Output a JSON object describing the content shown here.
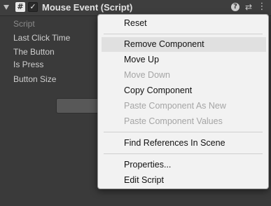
{
  "component": {
    "title": "Mouse Event (Script)",
    "enabled": true,
    "script_icon_glyph": "#",
    "check_glyph": "✓",
    "help_glyph": "?",
    "preset_glyph": "⇄",
    "more_glyph": "⋮"
  },
  "fields": {
    "script": "Script",
    "last_click_time": "Last Click Time",
    "the_button": "The Button",
    "is_press": "Is Press",
    "button_size": "Button Size"
  },
  "context_menu": {
    "hovered_item": "Remove Component",
    "items": [
      {
        "label": "Reset",
        "enabled": true
      },
      {
        "label": "Remove Component",
        "enabled": true
      },
      {
        "label": "Move Up",
        "enabled": true
      },
      {
        "label": "Move Down",
        "enabled": false
      },
      {
        "label": "Copy Component",
        "enabled": true
      },
      {
        "label": "Paste Component As New",
        "enabled": false
      },
      {
        "label": "Paste Component Values",
        "enabled": false
      },
      {
        "label": "Find References In Scene",
        "enabled": true
      },
      {
        "label": "Properties...",
        "enabled": true
      },
      {
        "label": "Edit Script",
        "enabled": true
      }
    ]
  },
  "colors": {
    "inspector_bg": "#3a3a3a",
    "menu_bg": "#f2f2f2",
    "menu_hover": "#e0e0e0",
    "disabled_text": "#a5a5a5"
  }
}
